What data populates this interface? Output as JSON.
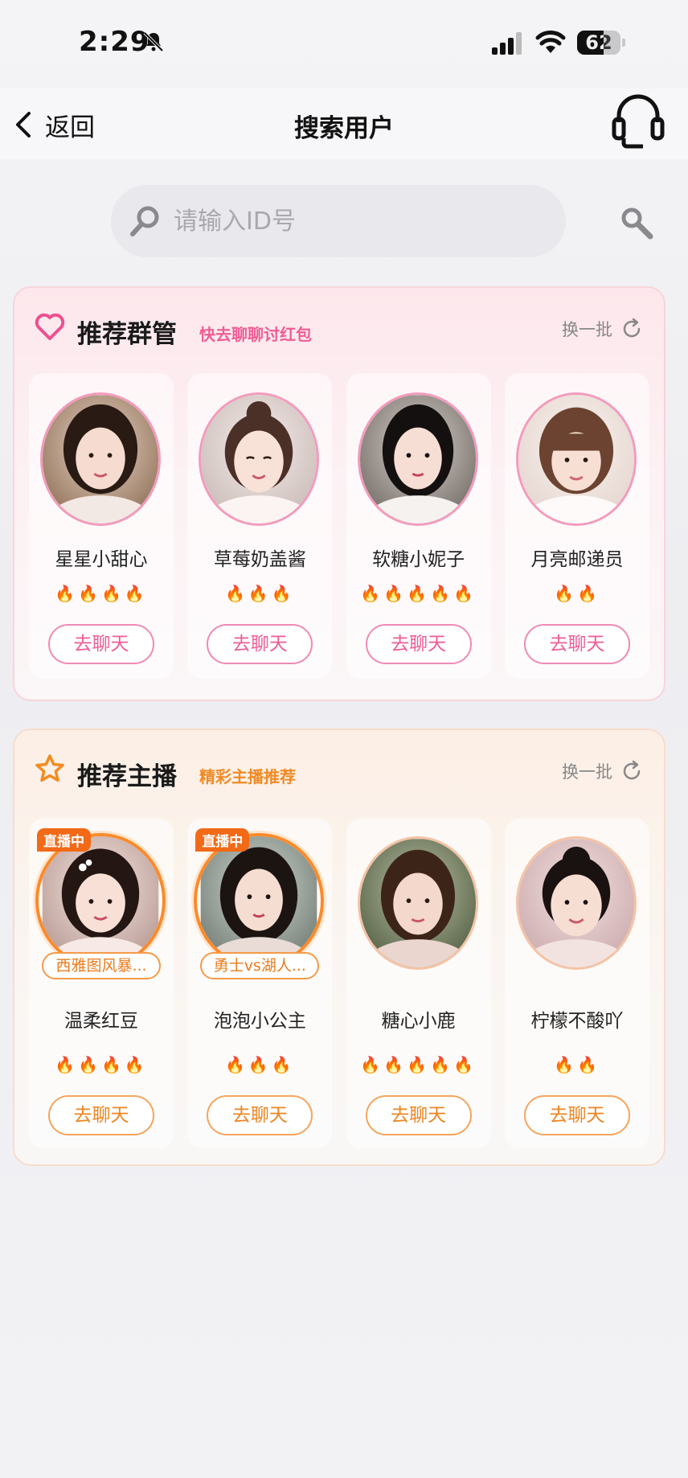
{
  "status_bar": {
    "time": "2:29",
    "battery_percent": 62,
    "battery_label": "62",
    "icons": [
      "bell-muted-icon",
      "signal-icon",
      "wifi-icon",
      "battery-icon"
    ]
  },
  "nav": {
    "back_label": "返回",
    "title": "搜索用户",
    "icons": [
      "chevron-left-icon",
      "headset-icon"
    ]
  },
  "search": {
    "placeholder": "请输入ID号",
    "value": ""
  },
  "group_admins": {
    "title": "推荐群管",
    "subtitle": "快去聊聊讨红包",
    "refresh_label": "换一批",
    "accent": "#ee5d95",
    "users": [
      {
        "name": "星星小甜心",
        "fire_count": 4,
        "fires": "🔥🔥🔥🔥",
        "chat_label": "去聊天"
      },
      {
        "name": "草莓奶盖酱",
        "fire_count": 3,
        "fires": "🔥🔥🔥",
        "chat_label": "去聊天"
      },
      {
        "name": "软糖小妮子",
        "fire_count": 5,
        "fires": "🔥🔥🔥🔥🔥",
        "chat_label": "去聊天"
      },
      {
        "name": "月亮邮递员",
        "fire_count": 2,
        "fires": "🔥🔥",
        "chat_label": "去聊天"
      }
    ]
  },
  "anchors": {
    "title": "推荐主播",
    "subtitle": "精彩主播推荐",
    "refresh_label": "换一批",
    "accent": "#f08a24",
    "users": [
      {
        "name": "温柔红豆",
        "live_label": "直播中",
        "room": "西雅图风暴...",
        "fire_count": 4,
        "fires": "🔥🔥🔥🔥",
        "chat_label": "去聊天"
      },
      {
        "name": "泡泡小公主",
        "live_label": "直播中",
        "room": "勇士vs湖人...",
        "fire_count": 3,
        "fires": "🔥🔥🔥",
        "chat_label": "去聊天"
      },
      {
        "name": "糖心小鹿",
        "fire_count": 5,
        "fires": "🔥🔥🔥🔥🔥",
        "chat_label": "去聊天"
      },
      {
        "name": "柠檬不酸吖",
        "fire_count": 2,
        "fires": "🔥🔥",
        "chat_label": "去聊天"
      }
    ]
  }
}
